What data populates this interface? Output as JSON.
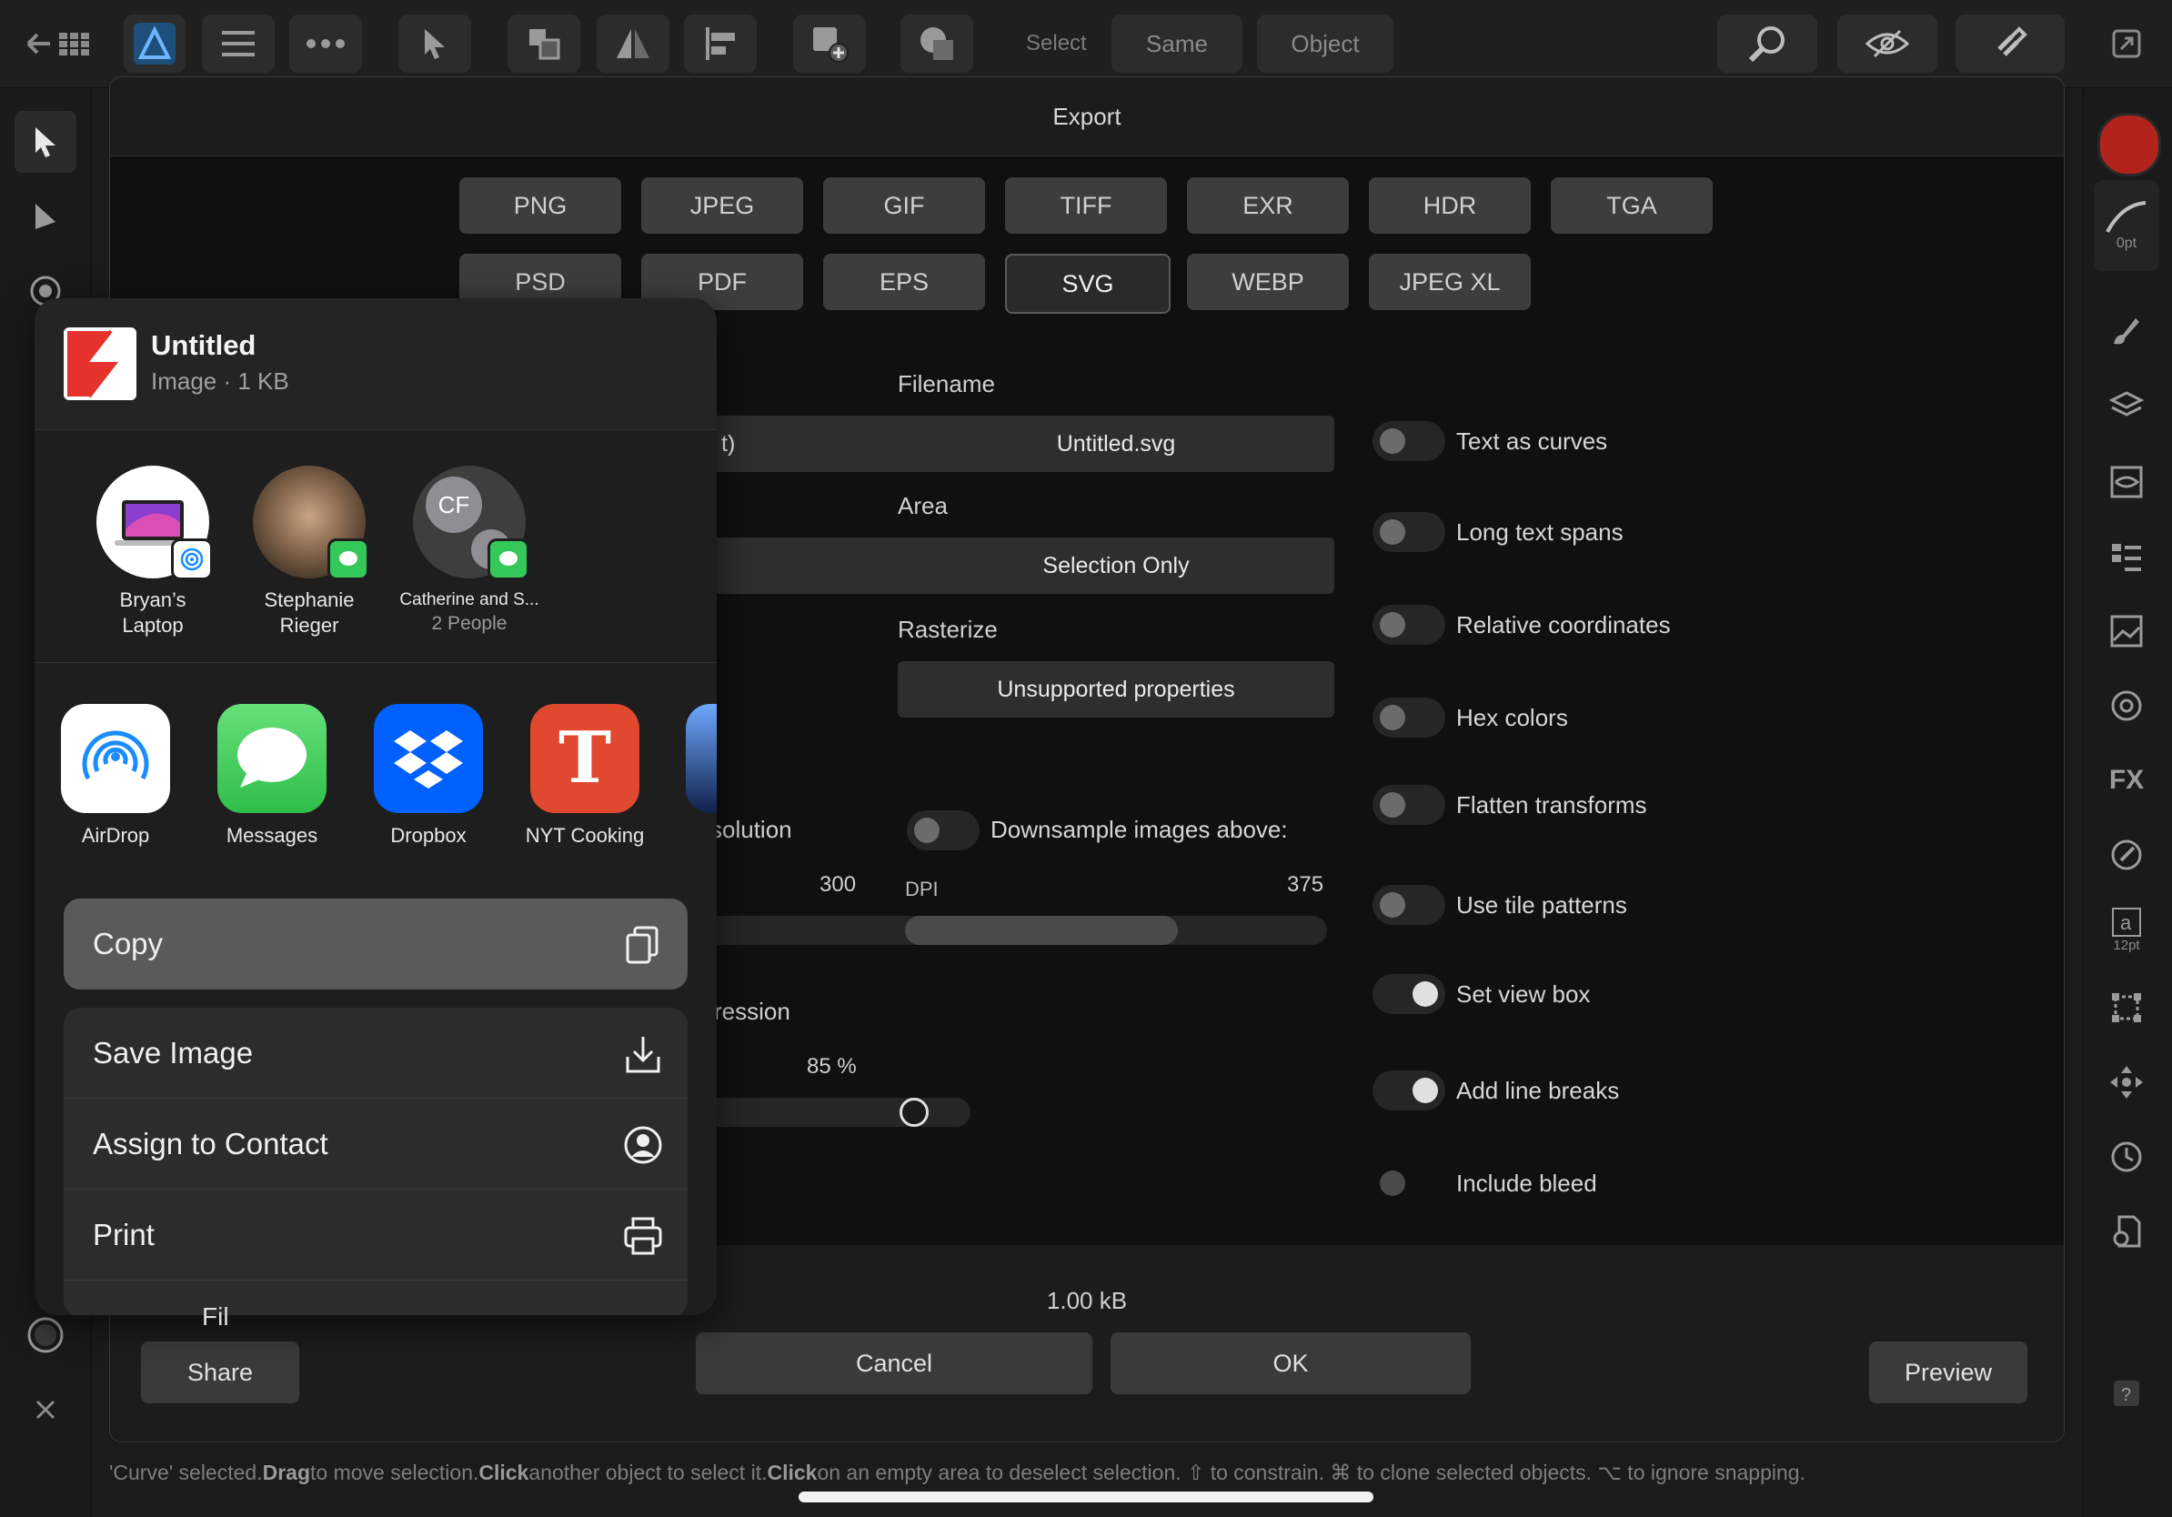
{
  "toolbar": {
    "select_label": "Select",
    "same_label": "Same",
    "object_label": "Object"
  },
  "dialog": {
    "title": "Export",
    "formats_row1": [
      "PNG",
      "JPEG",
      "GIF",
      "TIFF",
      "EXR",
      "HDR",
      "TGA"
    ],
    "formats_row2": [
      "PSD",
      "PDF",
      "EPS",
      "SVG",
      "WEBP",
      "JPEG XL"
    ],
    "selected_format": "SVG",
    "filename_label": "Filename",
    "filename_value": "Untitled.svg",
    "area_label": "Area",
    "area_value": "Selection Only",
    "rasterize_label": "Rasterize",
    "rasterize_value": "Unsupported properties",
    "preset_partial": "t)",
    "resolution_partial": "solution",
    "resolution_value": "300",
    "compression_partial": "ression",
    "compression_value": "85 %",
    "compression_fraction": 0.85,
    "downsample_label": "Downsample images above:",
    "dpi_label": "DPI",
    "dpi_value": "375",
    "toggles": [
      {
        "label": "Text as curves",
        "on": false
      },
      {
        "label": "Long text spans",
        "on": false
      },
      {
        "label": "Relative coordinates",
        "on": false
      },
      {
        "label": "Hex colors",
        "on": false
      },
      {
        "label": "Flatten transforms",
        "on": false
      },
      {
        "label": "Use tile patterns",
        "on": false
      },
      {
        "label": "Set view box",
        "on": true
      },
      {
        "label": "Add line breaks",
        "on": true
      },
      {
        "label": "Include bleed",
        "on": false
      }
    ],
    "file_size": "1.00 kB",
    "cancel_label": "Cancel",
    "ok_label": "OK",
    "share_label": "Share",
    "preview_label": "Preview"
  },
  "share_sheet": {
    "title": "Untitled",
    "subtitle": "Image · 1 KB",
    "people": [
      {
        "name_line1": "Bryan’s",
        "name_line2": "Laptop",
        "avatar_initials": ""
      },
      {
        "name_line1": "Stephanie",
        "name_line2": "Rieger",
        "avatar_initials": ""
      },
      {
        "name_line1": "Catherine and S...",
        "name_line2": "2 People",
        "avatar_initials": "CF"
      }
    ],
    "apps": [
      "AirDrop",
      "Messages",
      "Dropbox",
      "NYT Cooking"
    ],
    "copy_label": "Copy",
    "actions": [
      "Save Image",
      "Assign to Contact",
      "Print"
    ],
    "partial_text": "Fil"
  },
  "right_panel": {
    "stroke_width": "0pt",
    "font_size": "12pt"
  },
  "status_bar": {
    "parts": [
      {
        "text": "'Curve' selected. ",
        "bold": false
      },
      {
        "text": "Drag",
        "bold": true
      },
      {
        "text": " to move selection. ",
        "bold": false
      },
      {
        "text": "Click",
        "bold": true
      },
      {
        "text": " another object to select it. ",
        "bold": false
      },
      {
        "text": "Click",
        "bold": true
      },
      {
        "text": " on an empty area to deselect selection. ⇧ to constrain. ⌘ to clone selected objects. ⌥ to ignore snapping.",
        "bold": false
      }
    ]
  },
  "colors": {
    "accent_red": "#b0241c",
    "dialog_bg": "#101010",
    "button_bg": "#3d3d3d",
    "messages_green": "#34c759",
    "dropbox_blue": "#0061fe",
    "nyt_red": "#e0482f"
  }
}
